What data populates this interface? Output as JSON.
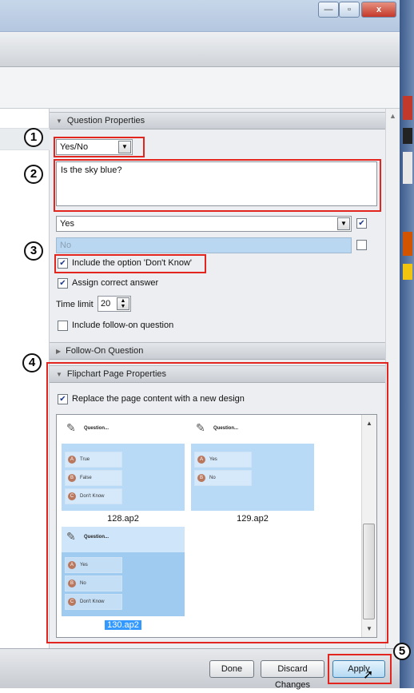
{
  "window": {
    "min_label": "—",
    "max_label": "▫",
    "close_label": "x"
  },
  "question_properties": {
    "header": "Question Properties",
    "question_type": "Yes/No",
    "question_text": "Is the sky blue?",
    "answer_1": "Yes",
    "answer_1_checked": true,
    "answer_2": "No",
    "answer_2_checked": false,
    "include_dont_know_label": "Include the option 'Don't Know'",
    "include_dont_know_checked": true,
    "assign_correct_label": "Assign correct answer",
    "assign_correct_checked": true,
    "time_limit_label": "Time limit",
    "time_limit_value": "20",
    "follow_on_label": "Include follow-on question",
    "follow_on_checked": false
  },
  "follow_on_section": {
    "header": "Follow-On Question"
  },
  "flipchart_properties": {
    "header": "Flipchart Page Properties",
    "replace_label": "Replace the page content with a new design",
    "replace_checked": true,
    "designs": [
      {
        "file": "128.ap2",
        "title": "Question...",
        "options": [
          {
            "letter": "A",
            "text": "True"
          },
          {
            "letter": "B",
            "text": "False"
          },
          {
            "letter": "C",
            "text": "Don't Know"
          }
        ]
      },
      {
        "file": "129.ap2",
        "title": "Question...",
        "options": [
          {
            "letter": "A",
            "text": "Yes"
          },
          {
            "letter": "B",
            "text": "No"
          }
        ]
      },
      {
        "file": "130.ap2",
        "title": "Question...",
        "options": [
          {
            "letter": "A",
            "text": "Yes"
          },
          {
            "letter": "B",
            "text": "No"
          },
          {
            "letter": "C",
            "text": "Don't Know"
          }
        ],
        "selected": true
      }
    ]
  },
  "buttons": {
    "done": "Done",
    "discard": "Discard Changes",
    "apply": "Apply"
  },
  "callouts": [
    "1",
    "2",
    "3",
    "4",
    "5"
  ],
  "colors": {
    "highlight_box": "#e2261f",
    "selection": "#3399ff"
  }
}
